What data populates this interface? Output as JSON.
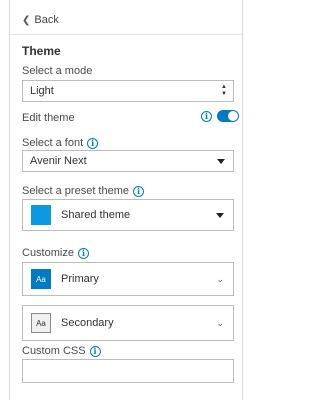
{
  "back": {
    "label": "Back"
  },
  "theme": {
    "section_title": "Theme",
    "mode": {
      "label": "Select a mode",
      "value": "Light"
    },
    "edit": {
      "label": "Edit theme",
      "toggle_on": true
    },
    "font": {
      "label": "Select a font",
      "value": "Avenir Next"
    },
    "preset": {
      "label": "Select a preset theme",
      "value": "Shared theme",
      "swatch_color": "#0d99e0"
    },
    "customize": {
      "label": "Customize",
      "items": [
        {
          "label": "Primary",
          "icon_text": "Aa",
          "color": "#007ac2"
        },
        {
          "label": "Secondary",
          "icon_text": "Aa",
          "color": "#f0f0f0"
        }
      ]
    },
    "css": {
      "label": "Custom CSS",
      "value": ""
    }
  },
  "colors": {
    "accent": "#007ac2",
    "border": "#bdbdbd"
  },
  "icons": {
    "back": "chevron-left-icon",
    "info": "info-icon",
    "dropdown": "caret-down-icon",
    "expand": "chevron-down-icon"
  }
}
